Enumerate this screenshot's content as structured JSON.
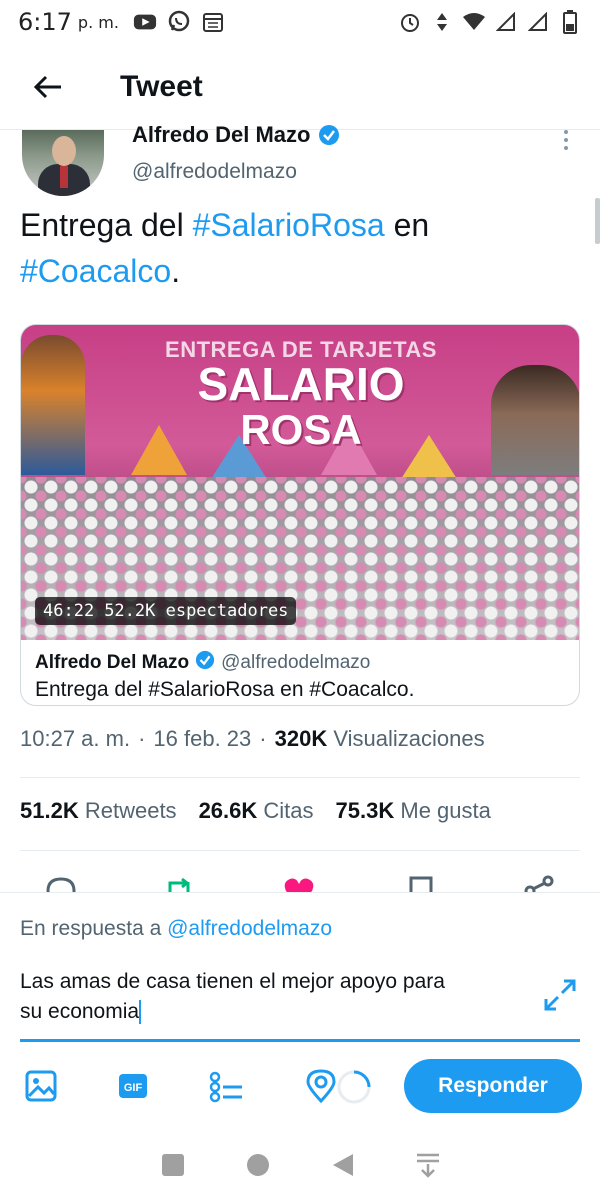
{
  "status_bar": {
    "time": "6:17",
    "ampm": "p. m.",
    "left_icons": [
      "youtube-icon",
      "whatsapp-icon",
      "calendar-icon"
    ],
    "right_icons": [
      "alarm-icon",
      "data-arrows-icon",
      "wifi-icon",
      "signal-icon",
      "signal-icon",
      "battery-icon"
    ]
  },
  "header": {
    "title": "Tweet",
    "back_icon": "arrow-left-icon"
  },
  "tweet": {
    "author_name": "Alfredo Del Mazo",
    "author_handle": "@alfredodelmazo",
    "text_parts": {
      "p1": "Entrega del ",
      "tag1": "#SalarioRosa",
      "p2": " en",
      "tag2": "#Coacalco",
      "p3": "."
    },
    "media": {
      "banner_line1": "ENTREGA DE TARJETAS",
      "banner_line2": "SALARIO",
      "banner_line3": "ROSA",
      "duration": "46:22",
      "viewers": "52.2K espectadores",
      "footer_author": "Alfredo Del Mazo",
      "footer_handle": "@alfredodelmazo",
      "footer_text": "Entrega del #SalarioRosa en #Coacalco."
    },
    "meta": {
      "time": "10:27 a. m.",
      "sep1": "·",
      "date": "16 feb. 23",
      "sep2": "·",
      "views_count": "320K",
      "views_label": "Visualizaciones"
    },
    "stats": {
      "retweets_count": "51.2K",
      "retweets_label": "Retweets",
      "quotes_count": "26.6K",
      "quotes_label": "Citas",
      "likes_count": "75.3K",
      "likes_label": "Me gusta"
    },
    "actions": [
      "reply-icon",
      "retweet-icon",
      "like-icon",
      "bookmark-icon",
      "share-icon"
    ]
  },
  "composer": {
    "reply_prefix": "En respuesta a",
    "reply_mention": "@alfredodelmazo",
    "input_line1": "Las amas de casa tienen el mejor apoyo  para",
    "input_line2": "su economia",
    "toolbar_icons": [
      "image-icon",
      "gif-icon",
      "poll-icon",
      "location-icon",
      "char-counter-icon"
    ],
    "submit_label": "Responder"
  },
  "navbar": {
    "icons": [
      "recents-icon",
      "home-icon",
      "back-icon",
      "notifications-down-icon"
    ]
  },
  "colors": {
    "accent": "#1d9bf0",
    "text_primary": "#0f1419",
    "text_secondary": "#536471",
    "like": "#f91880",
    "retweet": "#00ba7c"
  }
}
